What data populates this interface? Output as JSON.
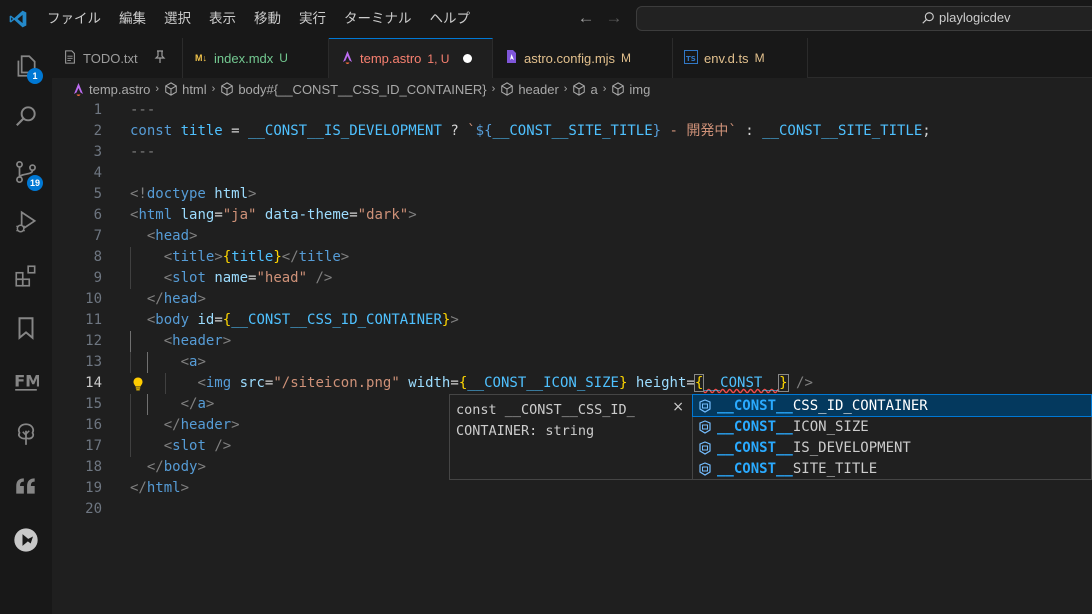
{
  "titlebar": {
    "menu": [
      "ファイル",
      "編集",
      "選択",
      "表示",
      "移動",
      "実行",
      "ターミナル",
      "ヘルプ"
    ],
    "search_text": "playlogicdev"
  },
  "activity_bar": {
    "explorer_badge": "1",
    "scm_badge": "19",
    "items": [
      "explorer",
      "search",
      "source-control",
      "run-debug",
      "extensions",
      "bookmarks",
      "front-matter",
      "tree",
      "quotes",
      "remote"
    ]
  },
  "tabs": [
    {
      "label": "TODO.txt",
      "status": "",
      "icon": "text-file-icon"
    },
    {
      "label": "index.mdx",
      "status": "U",
      "icon": "mdx-file-icon"
    },
    {
      "label": "temp.astro",
      "status": "1, U",
      "icon": "astro-file-icon"
    },
    {
      "label": "astro.config.mjs",
      "status": "M",
      "icon": "astro-file-icon"
    },
    {
      "label": "env.d.ts",
      "status": "M",
      "icon": "ts-file-icon"
    }
  ],
  "breadcrumb": [
    "temp.astro",
    "html",
    "body#{__CONST__CSS_ID_CONTAINER}",
    "header",
    "a",
    "img"
  ],
  "editor": {
    "line_numbers": [
      "1",
      "2",
      "3",
      "4",
      "5",
      "6",
      "7",
      "8",
      "9",
      "10",
      "11",
      "12",
      "13",
      "14",
      "15",
      "16",
      "17",
      "18",
      "19",
      "20"
    ],
    "current_line": "14",
    "lines": {
      "l1": "---",
      "l2_kw": "const",
      "l2_var": "title",
      "l2_eq": " = ",
      "l2_c1": "__CONST__IS_DEVELOPMENT",
      "l2_q": " ? ",
      "l2_bt": "`",
      "l2_dl": "${",
      "l2_c2": "__CONST__SITE_TITLE",
      "l2_rb": "}",
      "l2_s": " - 開発中",
      "l2_colon": " : ",
      "l2_c3": "__CONST__SITE_TITLE",
      "l2_semi": ";",
      "l3": "---",
      "l5_a": "<!",
      "l5_b": "doctype",
      "l5_c": " html",
      "l5_d": ">",
      "l6_tag": "html",
      "l6_a1": "lang",
      "l6_v1": "\"ja\"",
      "l6_a2": "data-theme",
      "l6_v2": "\"dark\"",
      "l7_tag": "head",
      "l8_tag": "title",
      "l8_expr": "title",
      "l9_tag": "slot",
      "l9_attr": "name",
      "l9_val": "\"head\"",
      "l10_tag": "head",
      "l11_tag": "body",
      "l11_attr": "id",
      "l11_expr": "__CONST__CSS_ID_CONTAINER",
      "l12_tag": "header",
      "l13_tag": "a",
      "l14_tag": "img",
      "l14_a1": "src",
      "l14_v1": "\"/siteicon.png\"",
      "l14_a2": "width",
      "l14_e2": "__CONST__ICON_SIZE",
      "l14_a3": "height",
      "l14_e3": "__CONST__",
      "l15_tag": "a",
      "l16_tag": "header",
      "l17_tag": "slot",
      "l18_tag": "body",
      "l19_tag": "html"
    }
  },
  "suggest": {
    "doc": "const __CONST__CSS_ID_\nCONTAINER: string",
    "close": "×",
    "items": [
      {
        "match": "__CONST__",
        "rest": "CSS_ID_CONTAINER"
      },
      {
        "match": "__CONST__",
        "rest": "ICON_SIZE"
      },
      {
        "match": "__CONST__",
        "rest": "IS_DEVELOPMENT"
      },
      {
        "match": "__CONST__",
        "rest": "SITE_TITLE"
      }
    ]
  },
  "colors": {
    "accent": "#0078d4",
    "editor_bg": "#1f1f1f",
    "keyword": "#569cd6",
    "string": "#ce9178",
    "attribute": "#9cdcfe",
    "constant": "#4fc1ff"
  }
}
